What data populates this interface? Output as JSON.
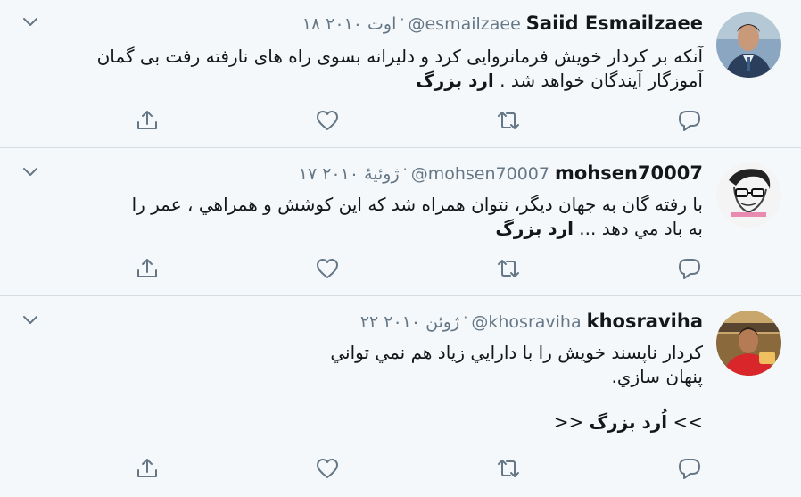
{
  "tweets": [
    {
      "name": "Saiid Esmailzaee",
      "handle": "@esmailzaee",
      "date": "۱۸ اوت ۲۰۱۰",
      "line1": "آنکه بر کردار خویش فرمانروایی کرد و دلیرانه بسوی راه های نارفته رفت بی گمان",
      "line2_text": "آموزگار آیندگان خواهد شد .",
      "line2_bold": "ارد بزرگ",
      "avatar_icon": "avatar-photo-suit",
      "actions": [
        "reply-icon",
        "retweet-icon",
        "like-icon",
        "share-icon"
      ]
    },
    {
      "name": "mohsen70007",
      "handle": "@mohsen70007",
      "date": "۱۷ ژوئیهٔ ۲۰۱۰",
      "line1": "با  رفته گان به جهان ديگر، نتوان همراه شد  که  اين کوشش و همراهي ، عمر را",
      "line2_text": "به باد مي دهد ...",
      "line2_bold": "ارد بزرگ",
      "avatar_icon": "avatar-sketch-glasses",
      "actions": [
        "reply-icon",
        "retweet-icon",
        "like-icon",
        "share-icon"
      ]
    },
    {
      "name": "khosraviha",
      "handle": "@khosraviha",
      "date": "۲۲ ژوئن ۲۰۱۰",
      "line1": "کردار ناپسند خويش را با دارايي زياد هم نمي تواني",
      "line2_text": "پنهان سازي.",
      "line3_prefix": "<<",
      "line3_bold": "اُرد بزرگ",
      "line3_suffix": ">>",
      "avatar_icon": "avatar-photo-red-shirt",
      "actions": [
        "reply-icon",
        "retweet-icon",
        "like-icon",
        "share-icon"
      ]
    }
  ],
  "colors": {
    "background": "#f5f8fa",
    "text": "#14171a",
    "secondary": "#657786",
    "divider": "#d4dbe1"
  }
}
